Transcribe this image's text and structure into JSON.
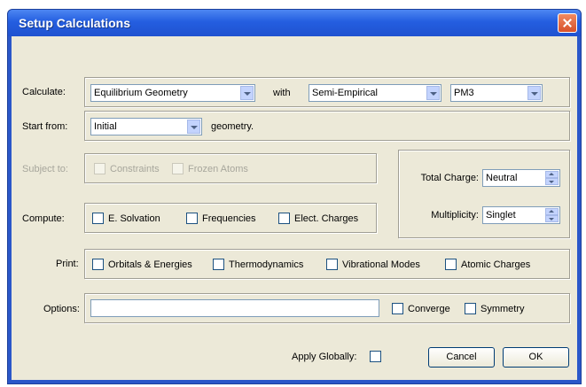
{
  "window": {
    "title": "Setup Calculations"
  },
  "calculate": {
    "label": "Calculate:",
    "method": "Equilibrium Geometry",
    "with_label": "with",
    "theory": "Semi-Empirical",
    "basis": "PM3"
  },
  "start": {
    "label": "Start from:",
    "value": "Initial",
    "suffix": "geometry."
  },
  "subject": {
    "label": "Subject to:",
    "constraints": "Constraints",
    "frozen_atoms": "Frozen Atoms"
  },
  "charge": {
    "total_label": "Total Charge:",
    "total_value": "Neutral",
    "mult_label": "Multiplicity:",
    "mult_value": "Singlet"
  },
  "compute": {
    "label": "Compute:",
    "solvation": "E. Solvation",
    "frequencies": "Frequencies",
    "elect_charges": "Elect. Charges"
  },
  "print": {
    "label": "Print:",
    "orbitals": "Orbitals & Energies",
    "thermo": "Thermodynamics",
    "vib_modes": "Vibrational Modes",
    "atomic_charges": "Atomic Charges"
  },
  "options": {
    "label": "Options:",
    "value": "",
    "converge": "Converge",
    "symmetry": "Symmetry"
  },
  "footer": {
    "apply_globally": "Apply Globally:",
    "cancel": "Cancel",
    "ok": "OK"
  },
  "colors": {
    "title_bar": "#245ee0",
    "dialog_bg": "#ece9d8",
    "close_button": "#d8512a"
  },
  "icons": {
    "close": "close-icon"
  }
}
